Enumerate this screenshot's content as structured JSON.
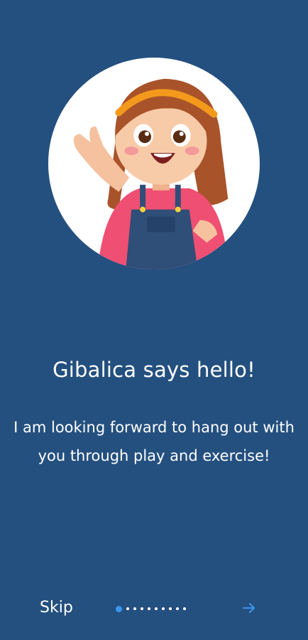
{
  "onboarding": {
    "title": "Gibalica says hello!",
    "body": "I am looking forward to hang out with you through play and exercise!",
    "illustration_icon": "girl-waving-illustration"
  },
  "footer": {
    "skip_label": "Skip",
    "next_icon": "arrow-right-icon",
    "page_index": 1,
    "page_count": 10
  },
  "colors": {
    "background": "#24507f",
    "accent": "#3d95ee",
    "text": "#ffffff"
  }
}
